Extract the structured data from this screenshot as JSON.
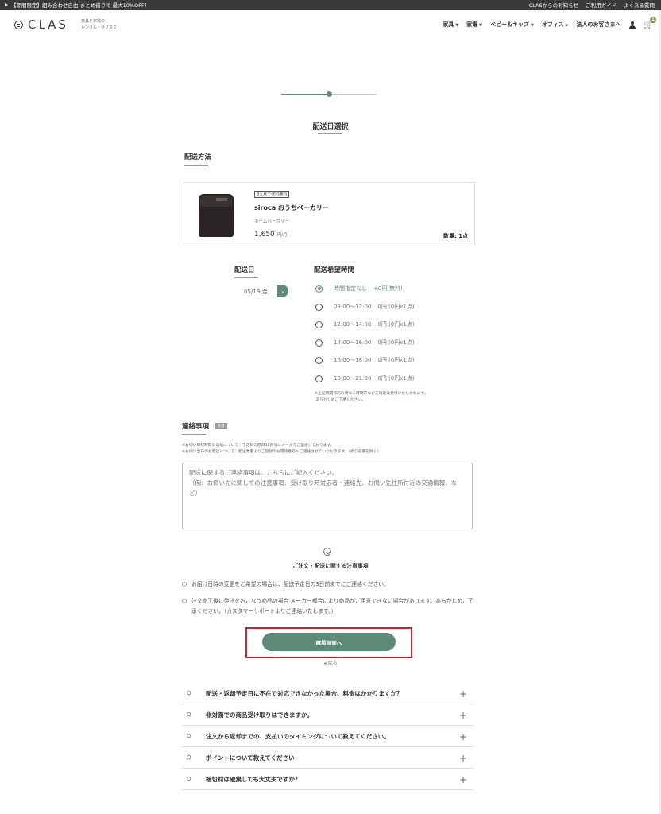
{
  "promo": {
    "text": "【期間限定】組み合わせ自由 まとめ借りで 最大10%OFF！",
    "links": [
      "CLASからのお知らせ",
      "ご利用ガイド",
      "よくある質問"
    ]
  },
  "header": {
    "logo": "CLAS",
    "tagline_1": "家具と家電の",
    "tagline_2": "レンタル・サブスク",
    "nav": [
      "家具",
      "家電",
      "ベビー＆キッズ",
      "オフィス",
      "法人のお客さまへ"
    ],
    "cart_count": "1"
  },
  "progress": {
    "step_fraction": 0.5
  },
  "page": {
    "title": "配送日選択",
    "delivery_method_title": "配送方法"
  },
  "product": {
    "tag": "3ヵ月で送料無料",
    "name": "siroca おうちベーカリー",
    "category": "ホームベーカリー",
    "price": "1,650",
    "price_unit": "円/月",
    "quantity": "数量: 1点"
  },
  "delivery": {
    "date_title": "配送日",
    "date_value": "05/19(金)",
    "time_title": "配送希望時間",
    "slots": [
      {
        "time": "時間指定なし",
        "price": "+0円(無料)",
        "selected": true
      },
      {
        "time": "08:00～12:00",
        "price": "0円 (0円x1点)",
        "selected": false
      },
      {
        "time": "12:00～14:00",
        "price": "0円 (0円x1点)",
        "selected": false
      },
      {
        "time": "14:00～16:00",
        "price": "0円 (0円x1点)",
        "selected": false
      },
      {
        "time": "16:00～18:00",
        "price": "0円 (0円x1点)",
        "selected": false
      },
      {
        "time": "18:00～21:00",
        "price": "0円 (0円x1点)",
        "selected": false
      }
    ],
    "note_1": "※上記時間枠内の異なる時間帯などご指定は受付いたしかねます。",
    "note_2": "あらかじめご了承ください。"
  },
  "contact": {
    "title": "連絡事項",
    "badge": "任意",
    "note_1": "※お伺い日程時間の連絡について：予定日の前日18時頃にメールでご連絡しております。",
    "note_2": "※お伺い当日のお電話について：配送業者よりご登録のお電話番号へご連絡させていただきます。（折り返要を除く）",
    "placeholder": "配送に関するご連絡事項は、こちらにご記入ください。\n（例：お伺い先に関しての注意事項、受け取り時対応者・連絡先、お伺い先住所付近の交通情報、など）"
  },
  "notice": {
    "title": "ご注文・配送に関する注意事項",
    "item_1": "お届け日時の変更をご希望の場合は、配送予定日の3日前までにご連絡ください。",
    "item_2": "注文完了後に発注をおこなう商品の場合 メーカー都合により商品がご用意できない場合があります。あらかじめご了承ください。（カスタマーサポートよりご連絡いたします。）"
  },
  "actions": {
    "confirm": "確認画面へ",
    "back": "◂ 戻る"
  },
  "faq": [
    {
      "q": "Q",
      "text": "配送・返却予定日に不在で対応できなかった場合、料金はかかりますか？"
    },
    {
      "q": "Q",
      "text": "非対面での商品受け取りはできますか。"
    },
    {
      "q": "Q",
      "text": "注文から返却までの、支払いのタイミングについて教えてください。"
    },
    {
      "q": "Q",
      "text": "ポイントについて教えてください"
    },
    {
      "q": "Q",
      "text": "梱包材は破棄しても大丈夫ですか？"
    }
  ]
}
